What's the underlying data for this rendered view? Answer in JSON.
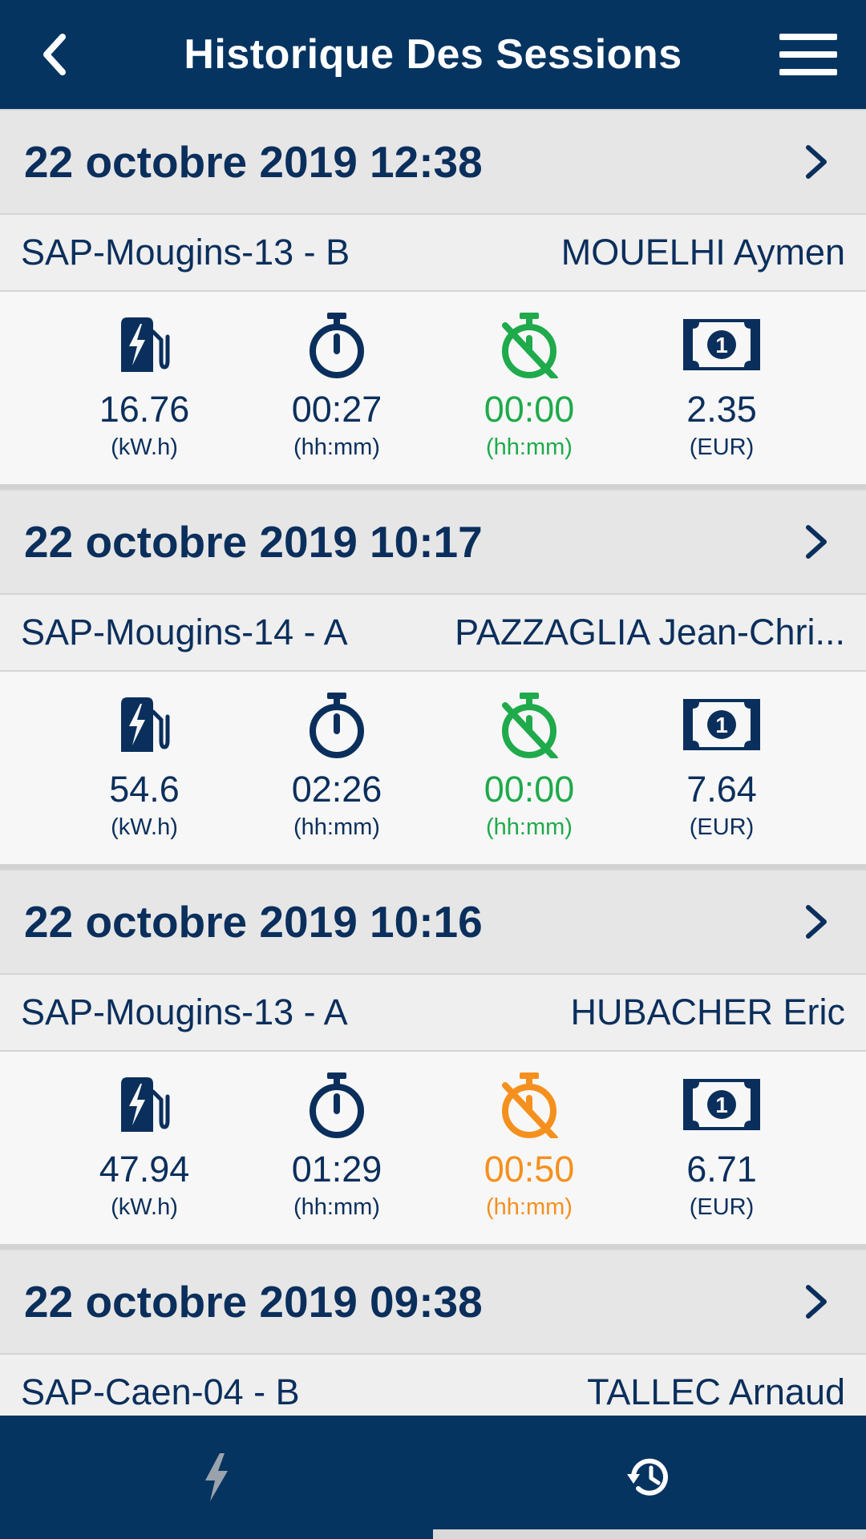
{
  "header": {
    "title": "Historique Des Sessions",
    "back_icon": "chevron-left-icon",
    "menu_icon": "hamburger-menu-icon"
  },
  "colors": {
    "primary": "#053461",
    "text": "#0b2f5c",
    "idle_ok": "#1faa4b",
    "idle_warn": "#f5901e"
  },
  "sessions": [
    {
      "date": "22 octobre 2019 12:38",
      "station": "SAP-Mougins-13 - B",
      "driver": "MOUELHI Aymen",
      "energy": "16.76",
      "energy_unit": "(kW.h)",
      "duration": "00:27",
      "duration_unit": "(hh:mm)",
      "idle": "00:00",
      "idle_unit": "(hh:mm)",
      "idle_status": "ok",
      "cost": "2.35",
      "cost_unit": "(EUR)"
    },
    {
      "date": "22 octobre 2019 10:17",
      "station": "SAP-Mougins-14 - A",
      "driver": "PAZZAGLIA Jean-Chri...",
      "energy": "54.6",
      "energy_unit": "(kW.h)",
      "duration": "02:26",
      "duration_unit": "(hh:mm)",
      "idle": "00:00",
      "idle_unit": "(hh:mm)",
      "idle_status": "ok",
      "cost": "7.64",
      "cost_unit": "(EUR)"
    },
    {
      "date": "22 octobre 2019 10:16",
      "station": "SAP-Mougins-13 - A",
      "driver": "HUBACHER Eric",
      "energy": "47.94",
      "energy_unit": "(kW.h)",
      "duration": "01:29",
      "duration_unit": "(hh:mm)",
      "idle": "00:50",
      "idle_unit": "(hh:mm)",
      "idle_status": "warn",
      "cost": "6.71",
      "cost_unit": "(EUR)"
    },
    {
      "date": "22 octobre 2019 09:38",
      "station": "SAP-Caen-04 - B",
      "driver": "TALLEC Arnaud"
    }
  ],
  "tabs": [
    {
      "icon": "lightning-icon",
      "active": false
    },
    {
      "icon": "history-icon",
      "active": true
    }
  ]
}
